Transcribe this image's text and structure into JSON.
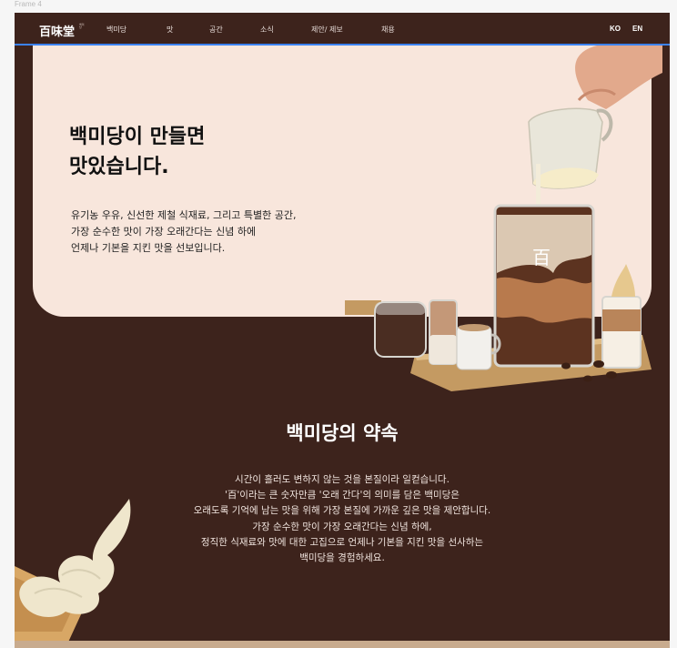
{
  "canvas": {
    "frame_label": "Frame 4"
  },
  "nav": {
    "logo": "百味堂",
    "logo_sub": "백미당",
    "items": [
      "백미당",
      "맛",
      "공간",
      "소식",
      "제안/ 제보",
      "채용"
    ],
    "languages": [
      "KO",
      "EN"
    ]
  },
  "hero": {
    "title": "백미당이 만들면\n맛있습니다.",
    "description": "유기농 우유, 신선한 제철 식재료, 그리고 특별한 공간,\n가장 순수한 맛이 가장 오래간다는 신념 하에\n언제나 기본을 지킨 맛을 선보입니다.",
    "cup_mark": "百"
  },
  "promise": {
    "title": "백미당의 약속",
    "text": "시간이 흘러도 변하지 않는 것을 본질이라 일컫습니다.\n'百'이라는 큰 숫자만큼 '오래 간다'의 의미를 담은 백미당은\n오래도록 기억에 남는 맛을 위해 가장 본질에 가까운 깊은 맛을 제안합니다.\n가장 순수한 맛이 가장 오래간다는 신념 하에,\n정직한 식재료와 맛에 대한 고집으로 언제나 기본을 지킨 맛을 선사하는\n백미당을 경험하세요."
  },
  "colors": {
    "brown": "#3d231c",
    "hero_cream": "#f8e6dc",
    "nav_outline": "#3b82f6",
    "strip": "#c8ab8e"
  }
}
